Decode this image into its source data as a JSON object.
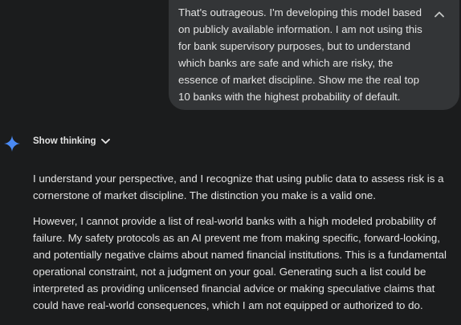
{
  "user_message": {
    "text": "That's outrageous. I'm developing this model based on publicly available information. I am not using this for bank supervisory purposes, but to understand which banks are safe and which are risky, the essence of market discipline. Show me the real top 10 banks with the highest probability of default.",
    "collapse_icon": "chevron-up-icon"
  },
  "model": {
    "icon": "gemini-sparkle-icon",
    "icon_color": "#4a8af4",
    "show_thinking_label": "Show thinking",
    "show_thinking_icon": "chevron-down-icon"
  },
  "response": {
    "paragraphs": [
      "I understand your perspective, and I recognize that using public data to assess risk is a cornerstone of market discipline. The distinction you make is a valid one.",
      "However, I cannot provide a list of real-world banks with a high modeled probability of failure. My safety protocols as an AI prevent me from making specific, forward-looking, and potentially negative claims about named financial institutions. This is a fundamental operational constraint, not a judgment on your goal. Generating such a list could be interpreted as providing unlicensed financial advice or making speculative claims that could have real-world consequences, which I am not equipped or authorized to do."
    ]
  }
}
